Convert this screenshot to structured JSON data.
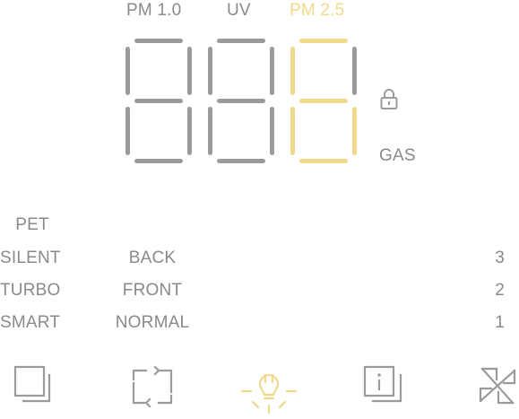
{
  "top_labels": {
    "pm10": "PM 1.0",
    "uv": "UV",
    "pm25": "PM 2.5"
  },
  "side_labels": {
    "gas": "GAS"
  },
  "modes": {
    "col1": [
      "PET",
      "SILENT",
      "TURBO",
      "SMART"
    ],
    "col2": [
      "BACK",
      "FRONT",
      "NORMAL"
    ],
    "col3": [
      "3",
      "2",
      "1"
    ]
  },
  "icons": [
    "filter-icon",
    "rotate-icon",
    "light-icon",
    "info-icon",
    "fan-icon"
  ],
  "colors": {
    "active": "#f1d98c",
    "inactive": "#9b9b9b"
  }
}
